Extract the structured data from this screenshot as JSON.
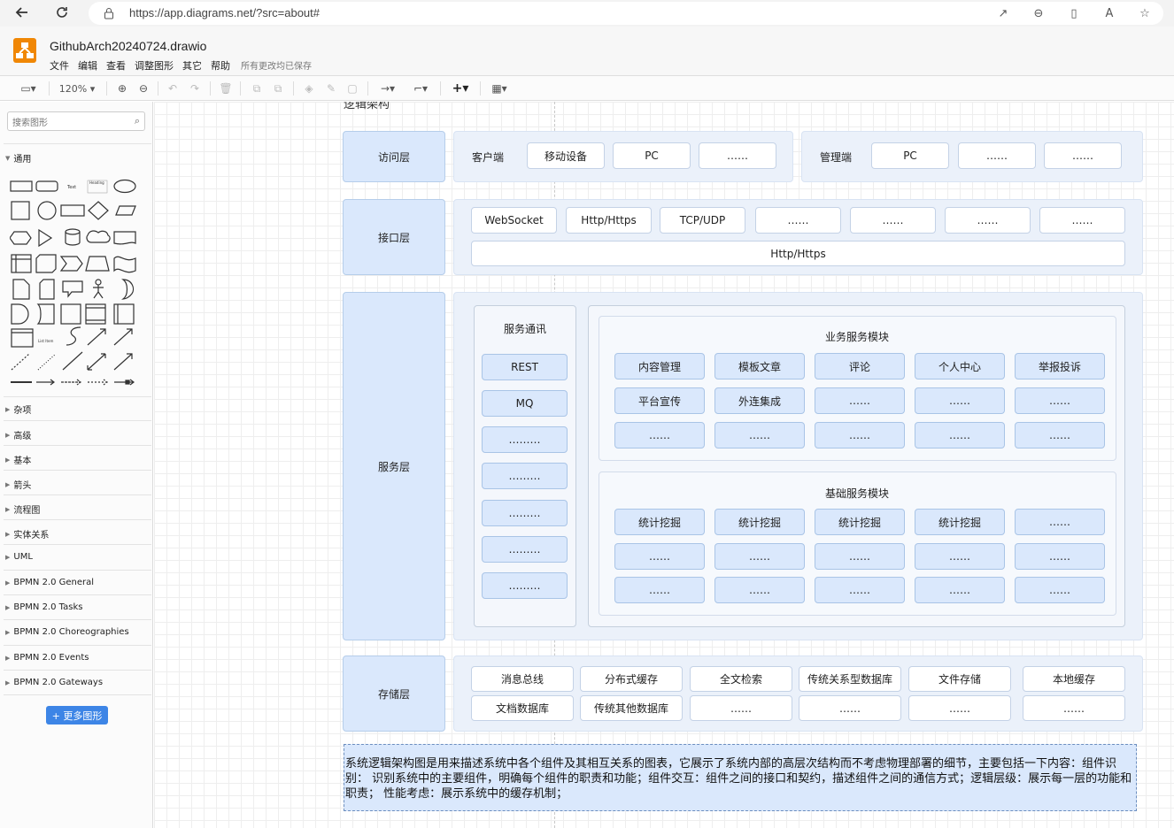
{
  "browser": {
    "back_icon": "arrow-left-icon",
    "reload_icon": "reload-icon",
    "url": "https://app.diagrams.net/?src=about#"
  },
  "app": {
    "title": "GithubArch20240724.drawio",
    "brand_color": "#f08705",
    "menu": [
      "文件",
      "编辑",
      "查看",
      "调整图形",
      "其它",
      "帮助"
    ],
    "save_status": "所有更改均已保存"
  },
  "toolbar": {
    "zoom": "120%"
  },
  "sidebar": {
    "search_placeholder": "搜索图形",
    "open_section": "通用",
    "sections": [
      "杂项",
      "高级",
      "基本",
      "箭头",
      "流程图",
      "实体关系",
      "UML",
      "BPMN 2.0 General",
      "BPMN 2.0 Tasks",
      "BPMN 2.0 Choreographies",
      "BPMN 2.0 Events",
      "BPMN 2.0 Gateways"
    ],
    "more_shapes": "+ 更多图形"
  },
  "diagram": {
    "title_fragment": "逻辑架构",
    "access": {
      "label": "访问层",
      "client": {
        "label": "客户端",
        "items": [
          "移动设备",
          "PC",
          "……"
        ]
      },
      "admin": {
        "label": "管理端",
        "items": [
          "PC",
          "……",
          "……"
        ]
      }
    },
    "interface": {
      "label": "接口层",
      "items": [
        "WebSocket",
        "Http/Https",
        "TCP/UDP",
        "……",
        "……",
        "……",
        "……"
      ],
      "bar": "Http/Https"
    },
    "service": {
      "label": "服务层",
      "comm": {
        "title": "服务通讯",
        "items": [
          "REST",
          "MQ",
          "………",
          "………",
          "………",
          "………",
          "………"
        ]
      },
      "biz": {
        "title": "业务服务模块",
        "rows": [
          [
            "内容管理",
            "模板文章",
            "评论",
            "个人中心",
            "举报投诉"
          ],
          [
            "平台宣传",
            "外连集成",
            "……",
            "……",
            "……"
          ],
          [
            "……",
            "……",
            "……",
            "……",
            "……"
          ]
        ]
      },
      "base": {
        "title": "基础服务模块",
        "rows": [
          [
            "统计挖掘",
            "统计挖掘",
            "统计挖掘",
            "统计挖掘",
            "……"
          ],
          [
            "……",
            "……",
            "……",
            "……",
            "……"
          ],
          [
            "……",
            "……",
            "……",
            "……",
            "……"
          ]
        ]
      }
    },
    "storage": {
      "label": "存储层",
      "rows": [
        [
          "消息总线",
          "分布式缓存",
          "全文检索",
          "传统关系型数据库",
          "文件存储",
          "本地缓存"
        ],
        [
          "文档数据库",
          "传统其他数据库",
          "……",
          "……",
          "……",
          "……"
        ]
      ]
    },
    "note": "系统逻辑架构图是用来描述系统中各个组件及其相互关系的图表，它展示了系统内部的高层次结构而不考虑物理部署的细节，主要包括一下内容：组件识别： 识别系统中的主要组件，明确每个组件的职责和功能；组件交互：组件之间的接口和契约，描述组件之间的通信方式；逻辑层级：展示每一层的功能和职责；  性能考虑：展示系统中的缓存机制；"
  }
}
